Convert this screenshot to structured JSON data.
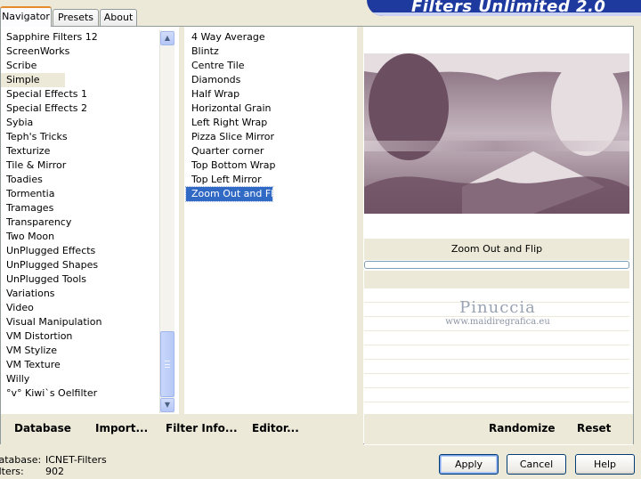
{
  "tabs": [
    {
      "label": "Navigator",
      "active": true
    },
    {
      "label": "Presets",
      "active": false
    },
    {
      "label": "About",
      "active": false
    }
  ],
  "title": "Filters Unlimited 2.0",
  "categories": [
    "Sapphire Filters 12",
    "ScreenWorks",
    "Scribe",
    "Simple",
    "Special Effects 1",
    "Special Effects 2",
    "Sybia",
    "Teph's Tricks",
    "Texturize",
    "Tile & Mirror",
    "Toadies",
    "Tormentia",
    "Tramages",
    "Transparency",
    "Two Moon",
    "UnPlugged Effects",
    "UnPlugged Shapes",
    "UnPlugged Tools",
    "Variations",
    "Video",
    "Visual Manipulation",
    "VM Distortion",
    "VM Stylize",
    "VM Texture",
    "Willy",
    "°v° Kiwi`s Oelfilter"
  ],
  "selected_category": "Simple",
  "filters": [
    "4 Way Average",
    "Blintz",
    "Centre Tile",
    "Diamonds",
    "Half Wrap",
    "Horizontal Grain",
    "Left Right Wrap",
    "Pizza Slice Mirror",
    "Quarter corner",
    "Top Bottom Wrap",
    "Top Left Mirror",
    "Zoom Out and Flip"
  ],
  "selected_filter": "Zoom Out and Flip",
  "preview": {
    "filter_name": "Zoom Out and Flip",
    "watermark_name": "Pinuccia",
    "watermark_url": "www.maidiregrafica.eu",
    "colors": {
      "dark": "#6b4e60",
      "mid": "#9c8595",
      "light": "#e6dde0"
    }
  },
  "toolbar": {
    "database": "Database",
    "import": "Import...",
    "filter_info": "Filter Info...",
    "editor": "Editor...",
    "randomize": "Randomize",
    "reset": "Reset"
  },
  "status": {
    "database_label": "Database:",
    "database_value": "ICNET-Filters",
    "filters_label": "Filters:",
    "filters_value": "902"
  },
  "buttons": {
    "apply": "Apply",
    "cancel": "Cancel",
    "help": "Help"
  }
}
